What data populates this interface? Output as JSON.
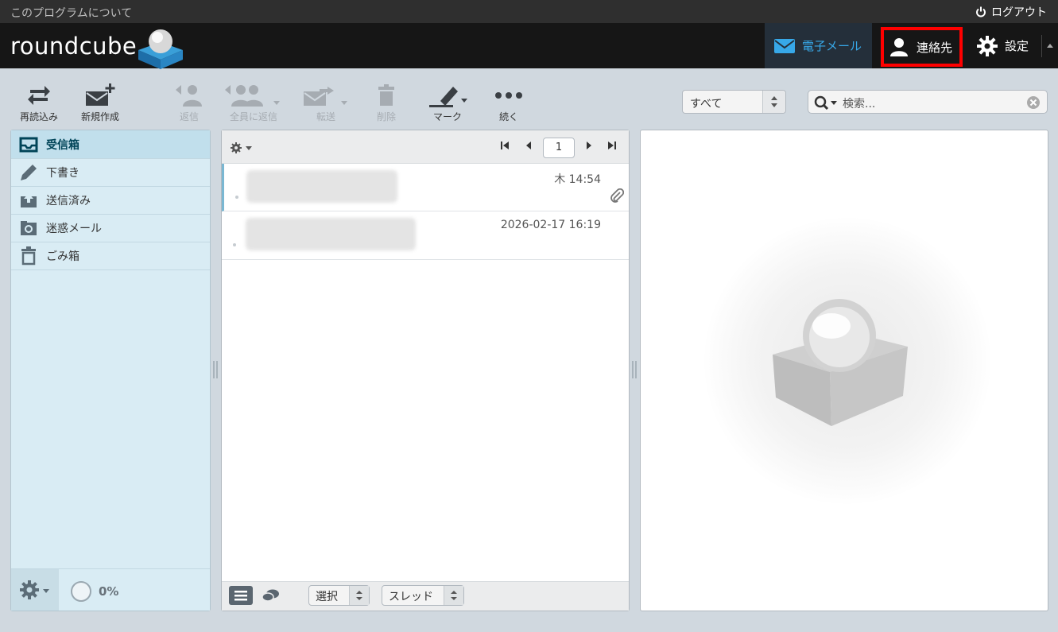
{
  "topline": {
    "about": "このプログラムについて",
    "logout": "ログアウト"
  },
  "header": {
    "logo": "roundcube",
    "nav": {
      "mail": "電子メール",
      "contacts": "連絡先",
      "settings": "設定"
    }
  },
  "toolbar": {
    "reload": "再読込み",
    "compose": "新規作成",
    "reply": "返信",
    "reply_all": "全員に返信",
    "forward": "転送",
    "delete": "削除",
    "mark": "マーク",
    "more": "続く"
  },
  "filter": {
    "selected": "すべて"
  },
  "search": {
    "placeholder": "検索..."
  },
  "folders": [
    {
      "label": "受信箱",
      "icon": "inbox-icon",
      "selected": true
    },
    {
      "label": "下書き",
      "icon": "pencil-icon"
    },
    {
      "label": "送信済み",
      "icon": "sent-icon"
    },
    {
      "label": "迷惑メール",
      "icon": "junk-icon"
    },
    {
      "label": "ごみ箱",
      "icon": "trash-icon"
    }
  ],
  "quota": "0%",
  "messagelist": {
    "page": "1",
    "messages": [
      {
        "date": "木 14:54",
        "has_attachment": true
      },
      {
        "date": "2026-02-17 16:19",
        "has_attachment": false
      }
    ],
    "footer": {
      "select": "選択",
      "threads": "スレッド"
    }
  },
  "colors": {
    "accent": "#37a8e8",
    "highlight_box": "#ff0000",
    "header_bg": "#161616"
  }
}
